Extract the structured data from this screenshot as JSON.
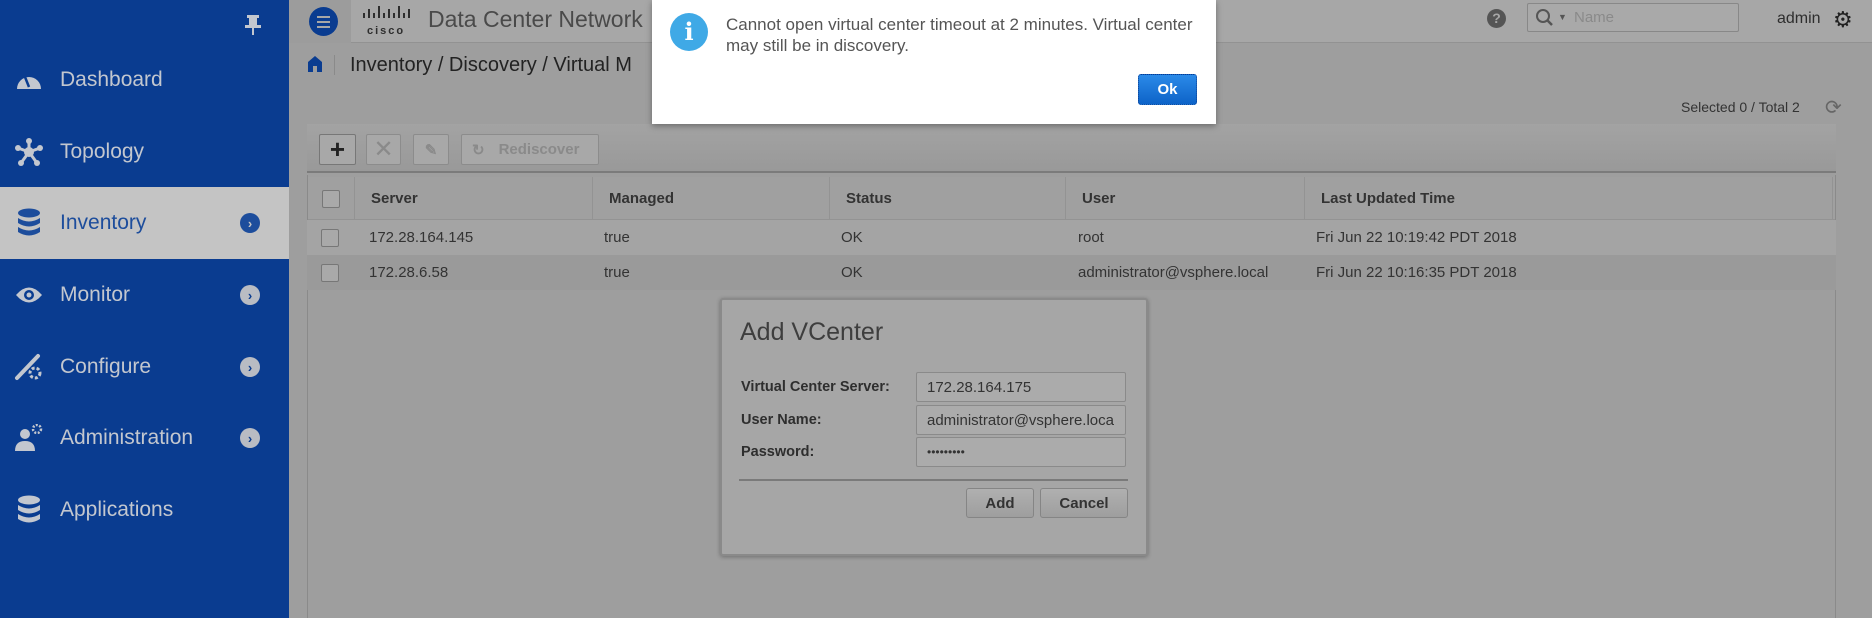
{
  "sidebar": {
    "items": [
      {
        "label": "Dashboard",
        "icon": "dashboard-icon"
      },
      {
        "label": "Topology",
        "icon": "topology-icon"
      },
      {
        "label": "Inventory",
        "icon": "database-icon",
        "active": true
      },
      {
        "label": "Monitor",
        "icon": "eye-icon"
      },
      {
        "label": "Configure",
        "icon": "configure-icon"
      },
      {
        "label": "Administration",
        "icon": "admin-icon"
      },
      {
        "label": "Applications",
        "icon": "database-icon"
      }
    ]
  },
  "header": {
    "logo": "cisco",
    "title": "Data Center Network",
    "search_placeholder": "Name",
    "user": "admin"
  },
  "breadcrumb": "Inventory / Discovery / Virtual M",
  "selection_status": "Selected 0 / Total 2",
  "toolbar": {
    "rediscover": "Rediscover",
    "add": "+"
  },
  "table": {
    "columns": [
      "Server",
      "Managed",
      "Status",
      "User",
      "Last Updated Time"
    ],
    "rows": [
      [
        "172.28.164.145",
        "true",
        "OK",
        "root",
        "Fri Jun 22 10:19:42 PDT 2018"
      ],
      [
        "172.28.6.58",
        "true",
        "OK",
        "administrator@vsphere.local",
        "Fri Jun 22 10:16:35 PDT 2018"
      ]
    ]
  },
  "add_dialog": {
    "title": "Add VCenter",
    "server_label": "Virtual Center Server:",
    "server_value": "172.28.164.175",
    "user_label": "User Name:",
    "user_value": "administrator@vsphere.loca",
    "password_label": "Password:",
    "password_value": "•••••••••",
    "add": "Add",
    "cancel": "Cancel"
  },
  "alert": {
    "message": "Cannot open virtual center timeout at 2 minutes. Virtual center may still be in discovery.",
    "ok": "Ok"
  }
}
